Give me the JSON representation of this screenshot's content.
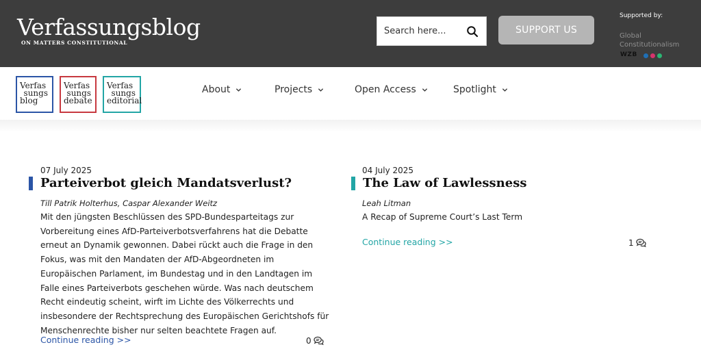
{
  "header": {
    "logo_title": "Verfassungsblog",
    "logo_subtitle": "ON MATTERS CONSTITUTIONAL",
    "search_placeholder": "Search here...",
    "support_label": "SUPPORT US",
    "supported_by_label": "Supported by:",
    "sponsor_name": "Global Constitutionalism",
    "sponsor_logo_text": "WZB",
    "sponsor_dot_colors": [
      "#1f6fb5",
      "#d6336c",
      "#2bb673"
    ]
  },
  "brands": [
    {
      "lines": [
        "Verfas",
        "sungs",
        "blog"
      ],
      "color": "#2b55a6"
    },
    {
      "lines": [
        "Verfas",
        "sungs",
        "debate"
      ],
      "color": "#c7383f"
    },
    {
      "lines": [
        "Verfas",
        "sungs",
        "editorial"
      ],
      "color": "#22a5a5"
    }
  ],
  "nav": {
    "items": [
      {
        "label": "About"
      },
      {
        "label": "Projects"
      },
      {
        "label": "Open Access"
      },
      {
        "label": "Spotlight"
      }
    ]
  },
  "articles": [
    {
      "date": "07 July 2025",
      "title": "Parteiverbot gleich Mandatsverlust?",
      "authors": "Till Patrik Holterhus, Caspar Alexander Weitz",
      "excerpt": "Mit den jüngsten Beschlüssen des SPD-Bundesparteitags zur Vorbereitung eines AfD-Parteiverbotsverfahrens hat die Debatte erneut an Dynamik gewonnen. Dabei rückt auch die Frage in den Fokus, was mit den Mandaten der AfD-Abgeordneten im Europäischen Parlament, im Bundestag und in den Landtagen im Falle eines Parteiverbots geschehen würde. Was nach deutschem Recht eindeutig scheint, wirft im Lichte des Völkerrechts und insbesondere der Rechtsprechung des Europäischen Gerichtshofs für Menschenrechte bisher nur selten beachtete Fragen auf.",
      "continue_label": "Continue reading >>",
      "comment_count": "0",
      "accent_color": "#2b55a6",
      "link_color": "#2b55a6"
    },
    {
      "date": "04 July 2025",
      "title": "The Law of Lawlessness",
      "authors": "Leah Litman",
      "excerpt": "A Recap of Supreme Court’s Last Term",
      "continue_label": "Continue reading >>",
      "comment_count": "1",
      "accent_color": "#22a5a5",
      "link_color": "#22a5a5"
    }
  ]
}
